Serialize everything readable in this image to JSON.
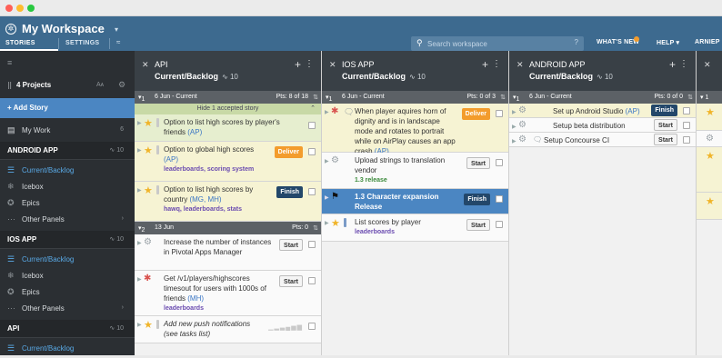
{
  "chrome": {
    "dots": [
      "#ff5f57",
      "#febc2e",
      "#28c840"
    ]
  },
  "nav": {
    "workspace_title": "My Workspace",
    "tab_stories": "STORIES",
    "tab_settings": "SETTINGS",
    "search_placeholder": "Search workspace",
    "whats_new": "WHAT'S NEW",
    "help": "HELP",
    "user": "ARNIEP"
  },
  "sidebar": {
    "projects_header": "4 Projects",
    "add_story": "+ Add Story",
    "my_work": "My Work",
    "my_work_count": "6",
    "sections": [
      {
        "name": "ANDROID APP",
        "velocity": "10",
        "items": [
          "Current/Backlog",
          "Icebox",
          "Epics",
          "Other Panels"
        ]
      },
      {
        "name": "IOS APP",
        "velocity": "10",
        "items": [
          "Current/Backlog",
          "Icebox",
          "Epics",
          "Other Panels"
        ]
      },
      {
        "name": "API",
        "velocity": "10",
        "items": [
          "Current/Backlog"
        ]
      }
    ]
  },
  "columns": [
    {
      "project": "API",
      "panel": "Current/Backlog",
      "velocity": "10",
      "color": "#394046",
      "iteration1": {
        "num": "1",
        "date": "6 Jun - Current",
        "pts": "Pts: 8 of 18"
      },
      "hidden_note": "Hide 1 accepted story",
      "stories1": [
        {
          "text": "Option to list high scores by player's friends",
          "who": "(AP)"
        },
        {
          "text": "Option to global high scores",
          "who": "(AP)",
          "labels": "leaderboards, scoring system",
          "button": "Deliver"
        },
        {
          "text": "Option to list high scores by country",
          "who": "(MG, MH)",
          "labels": "hawq, leaderboards, stats",
          "button": "Finish"
        }
      ],
      "iteration2": {
        "num": "2",
        "date": "13 Jun",
        "pts": "Pts: 0"
      },
      "stories2": [
        {
          "text": "Increase the number of instances in Pivotal Apps Manager",
          "button": "Start"
        },
        {
          "text": "Get /v1/players/highscores timesout for users with 1000s of friends",
          "who": "(MH)",
          "labels": "leaderboards",
          "button": "Start"
        },
        {
          "text": "Add new push notifications (see tasks list)"
        }
      ]
    },
    {
      "project": "IOS APP",
      "panel": "Current/Backlog",
      "velocity": "10",
      "color": "#394046",
      "iteration1": {
        "num": "1",
        "date": "6 Jun - Current",
        "pts": "Pts: 0 of 3"
      },
      "stories1": [
        {
          "text": "When player aquires horn of dignity and is in landscape mode and rotates to portrait while on AirPlay causes an app crash",
          "who": "(AP)",
          "button": "Deliver"
        },
        {
          "text": "Upload strings to translation vendor",
          "release": "1.3 release",
          "button": "Start"
        },
        {
          "text": "1.3 Character expansion Release",
          "button": "Finish"
        },
        {
          "text": "List scores by player",
          "labels": "leaderboards",
          "button": "Start"
        }
      ]
    },
    {
      "project": "ANDROID APP",
      "panel": "Current/Backlog",
      "velocity": "10",
      "color": "#394046",
      "iteration1": {
        "num": "1",
        "date": "6 Jun - Current",
        "pts": "Pts: 0 of 0"
      },
      "stories1": [
        {
          "text": "Set up Android Studio",
          "who": "(AP)",
          "button": "Finish"
        },
        {
          "text": "Setup beta distribution",
          "button": "Start"
        },
        {
          "text": "Setup Concourse CI",
          "button": "Start"
        }
      ]
    }
  ]
}
